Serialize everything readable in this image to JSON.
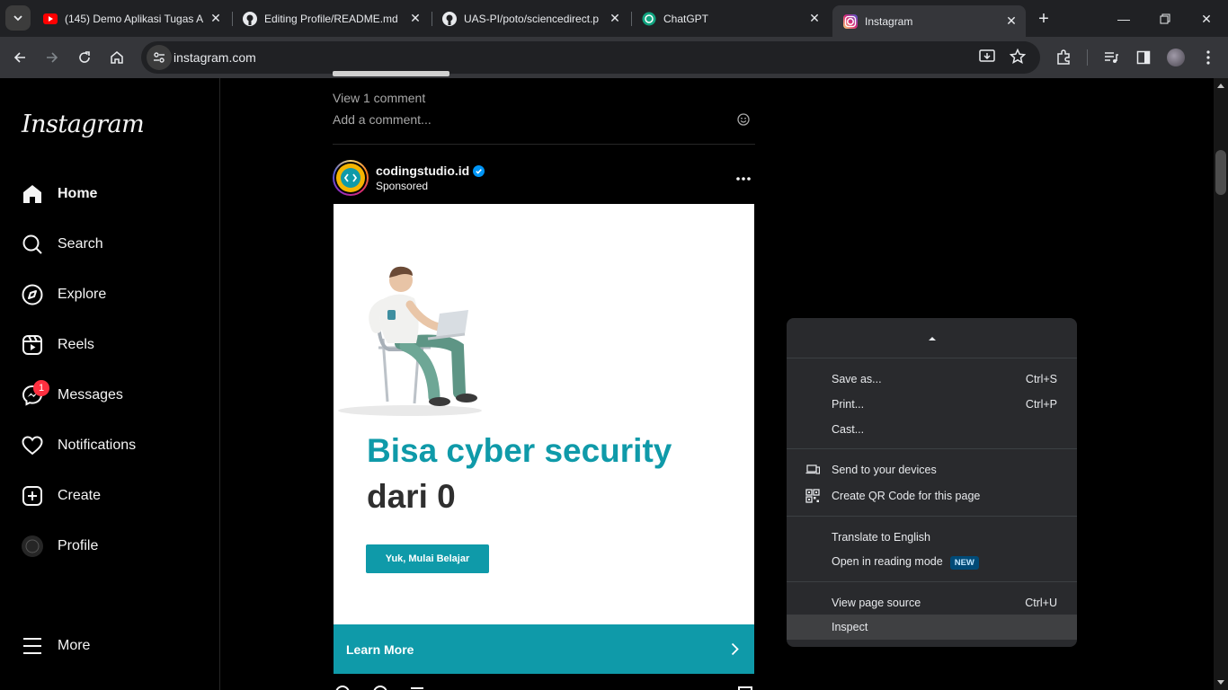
{
  "browser": {
    "tabs": [
      {
        "title": "(145) Demo Aplikasi Tugas A",
        "icon": "youtube-icon",
        "active": false
      },
      {
        "title": "Editing Profile/README.md",
        "icon": "github-icon",
        "active": false
      },
      {
        "title": "UAS-PI/poto/sciencedirect.p",
        "icon": "github-icon",
        "active": false
      },
      {
        "title": "ChatGPT",
        "icon": "chatgpt-icon",
        "active": false
      },
      {
        "title": "Instagram",
        "icon": "instagram-icon",
        "active": true
      }
    ],
    "url": "instagram.com"
  },
  "sidebar": {
    "logo": "Instagram",
    "items": [
      {
        "label": "Home",
        "icon": "home-icon"
      },
      {
        "label": "Search",
        "icon": "search-icon"
      },
      {
        "label": "Explore",
        "icon": "compass-icon"
      },
      {
        "label": "Reels",
        "icon": "reels-icon"
      },
      {
        "label": "Messages",
        "icon": "messenger-icon",
        "badge": "1"
      },
      {
        "label": "Notifications",
        "icon": "heart-icon"
      },
      {
        "label": "Create",
        "icon": "plus-square-icon"
      },
      {
        "label": "Profile",
        "icon": "avatar-icon"
      }
    ],
    "more": "More"
  },
  "feed": {
    "prev_post": {
      "view_comments": "View 1 comment",
      "add_comment_placeholder": "Add a comment..."
    },
    "post": {
      "username": "codingstudio.id",
      "subtitle": "Sponsored",
      "ad_headline_1": "Bisa cyber security",
      "ad_headline_2": "dari 0",
      "ad_button": "Yuk, Mulai Belajar",
      "cta": "Learn More"
    }
  },
  "context_menu": {
    "items": [
      {
        "label": "Save as...",
        "shortcut": "Ctrl+S"
      },
      {
        "label": "Print...",
        "shortcut": "Ctrl+P"
      },
      {
        "label": "Cast...",
        "shortcut": ""
      },
      {
        "label": "Send to your devices",
        "shortcut": "",
        "icon": "devices-icon"
      },
      {
        "label": "Create QR Code for this page",
        "shortcut": "",
        "icon": "qr-code-icon"
      },
      {
        "label": "Translate to English",
        "shortcut": ""
      },
      {
        "label": "Open in reading mode",
        "shortcut": "",
        "badge": "NEW"
      },
      {
        "label": "View page source",
        "shortcut": "Ctrl+U"
      },
      {
        "label": "Inspect",
        "shortcut": "",
        "highlighted": true
      }
    ]
  },
  "colors": {
    "teal": "#0f9aa9",
    "verified": "#0095f6",
    "notification": "#ff3040"
  }
}
